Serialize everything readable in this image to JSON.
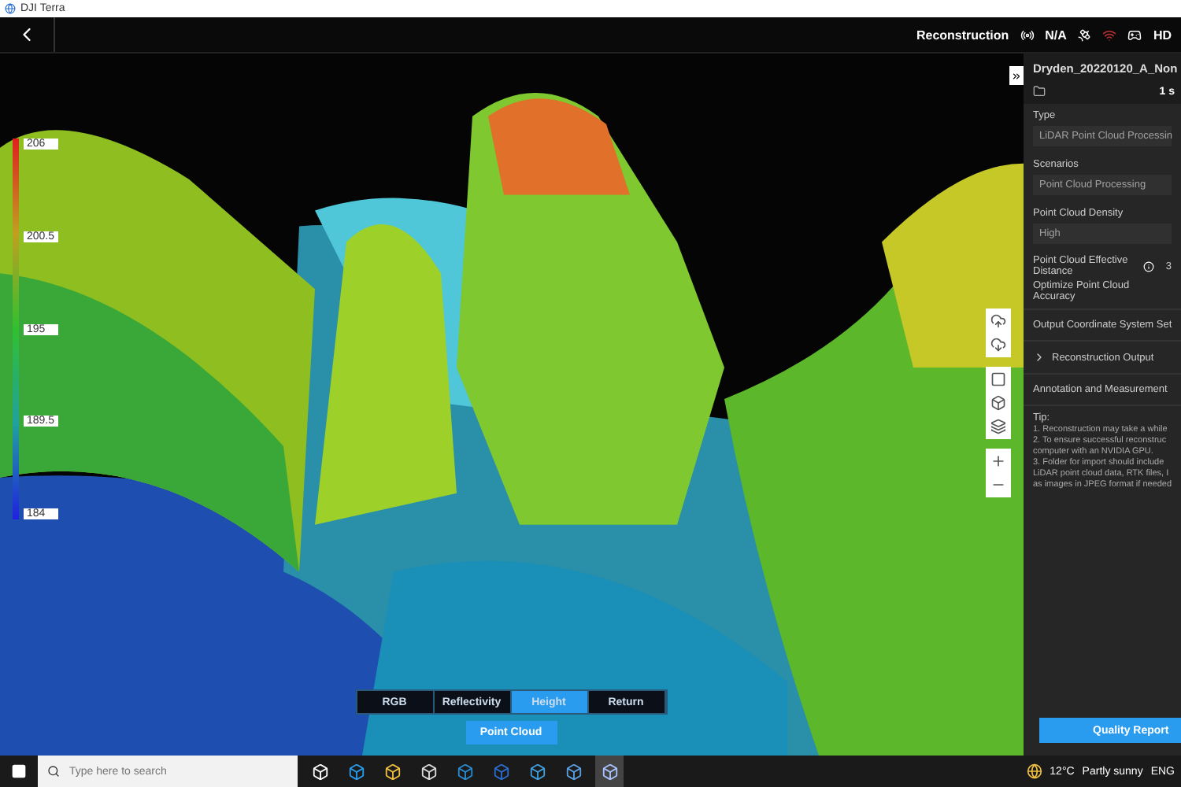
{
  "window": {
    "title": "DJI Terra"
  },
  "topbar": {
    "mode": "Reconstruction",
    "signal": "N/A",
    "video": "HD"
  },
  "legend": [
    "206",
    "200.5",
    "195",
    "189.5",
    "184"
  ],
  "view_tabs": [
    {
      "label": "RGB",
      "selected": false
    },
    {
      "label": "Reflectivity",
      "selected": false
    },
    {
      "label": "Height",
      "selected": true
    },
    {
      "label": "Return",
      "selected": false
    }
  ],
  "view_button": "Point Cloud",
  "panel": {
    "mission": "Dryden_20220120_A_Non",
    "count": "1 s",
    "fields": [
      {
        "label": "Type",
        "value": "LiDAR Point Cloud Processin"
      },
      {
        "label": "Scenarios",
        "value": "Point Cloud Processing"
      },
      {
        "label": "Point Cloud Density",
        "value": "High"
      }
    ],
    "distance": {
      "label": "Point Cloud Effective Distance",
      "value": "3"
    },
    "optimize": "Optimize Point Cloud Accuracy",
    "sections": [
      "Output Coordinate System Set",
      "Reconstruction Output",
      "Annotation and Measurement"
    ],
    "tip_title": "Tip:",
    "tips": [
      "1. Reconstruction may take a while",
      "2. To ensure successful reconstruc",
      "computer with an NVIDIA GPU.",
      "3. Folder for import should include",
      "LiDAR point cloud data, RTK files, I",
      "as images in JPEG format if needed"
    ],
    "report_button": "Quality Report"
  },
  "taskbar": {
    "search_placeholder": "Type here to search",
    "temperature": "12°C",
    "weather": "Partly sunny",
    "language": "ENG"
  }
}
